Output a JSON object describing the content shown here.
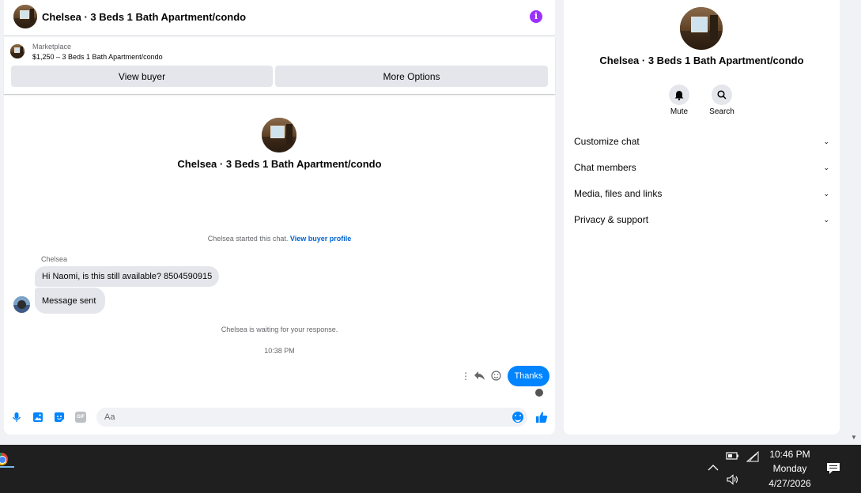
{
  "chat": {
    "title": "Chelsea · 3 Beds 1 Bath Apartment/condo",
    "marketplace_label": "Marketplace",
    "listing_line": "$1,250 – 3 Beds 1 Bath Apartment/condo",
    "view_buyer_label": "View buyer",
    "more_options_label": "More Options",
    "center_title": "Chelsea · 3 Beds 1 Bath Apartment/condo",
    "started_text": "Chelsea started this chat.",
    "view_buyer_profile": "View buyer profile",
    "sender_name": "Chelsea",
    "messages_in": [
      "Hi Naomi, is this still available? 8504590915",
      "Message sent"
    ],
    "waiting_text": "Chelsea is waiting for your response.",
    "timestamp": "10:38 PM",
    "message_out": "Thanks",
    "composer_placeholder": "Aa"
  },
  "sidebar": {
    "title": "Chelsea · 3 Beds 1 Bath Apartment/condo",
    "actions": [
      {
        "label": "Mute",
        "icon": "bell-icon"
      },
      {
        "label": "Search",
        "icon": "search-icon"
      }
    ],
    "sections": [
      "Customize chat",
      "Chat members",
      "Media, files and links",
      "Privacy & support"
    ]
  },
  "taskbar": {
    "time": "10:46 PM",
    "day": "Monday",
    "date": "4/27/2026"
  },
  "colors": {
    "accent": "#0084ff",
    "info": "#9b30ff",
    "link": "#0064d1"
  }
}
